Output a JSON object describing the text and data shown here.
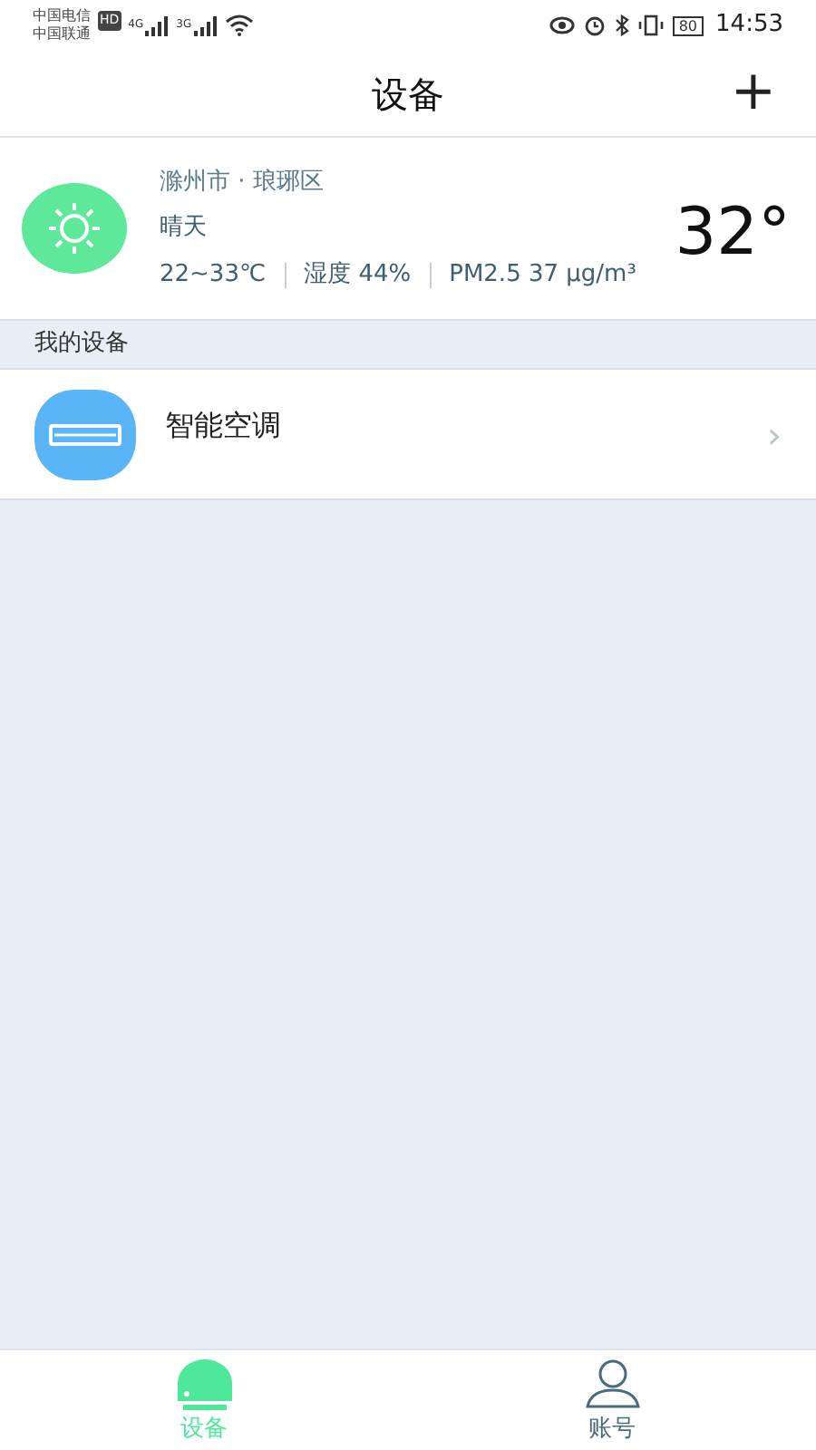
{
  "status_bar": {
    "carriers": [
      "中国电信",
      "中国联通"
    ],
    "hd_badge": "HD",
    "networks": [
      "4G",
      "3G"
    ],
    "battery": "80",
    "time": "14:53"
  },
  "header": {
    "title": "设备",
    "add_button": "+"
  },
  "weather": {
    "location": "滁州市 · 琅琊区",
    "condition": "晴天",
    "range": "22~33℃",
    "humidity": "湿度 44%",
    "pm25": "PM2.5 37 μg/m³",
    "temperature": "32°"
  },
  "section": {
    "title": "我的设备"
  },
  "devices": [
    {
      "name": "智能空调",
      "chevron": "›"
    }
  ],
  "tab_bar": [
    {
      "kind": "device",
      "label": "设备",
      "selected": true
    },
    {
      "kind": "account",
      "label": "账号",
      "selected": false
    }
  ]
}
